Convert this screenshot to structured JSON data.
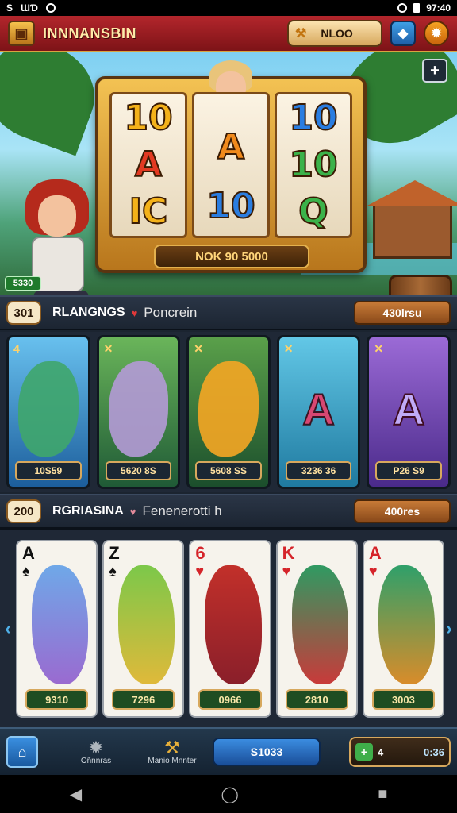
{
  "status_bar": {
    "left_icons": [
      "S",
      "ƜƊ"
    ],
    "right_text": "97:40"
  },
  "header": {
    "title": "INNNANSBIN",
    "coins": "NLOO",
    "logo_icon": "chest-icon"
  },
  "slot": {
    "reels": [
      [
        "10",
        "A",
        "IC"
      ],
      [
        "",
        "A",
        "10"
      ],
      [
        "10",
        "10",
        "Q"
      ]
    ],
    "bar_text": "NOK 90 5000"
  },
  "hero": {
    "level_chip": "5330"
  },
  "section1": {
    "num": "301",
    "title": "RLANGNGS",
    "subtitle": "Poncrein",
    "button": "430lrsu"
  },
  "cards1": [
    {
      "badge": "4",
      "label": "10S59",
      "color": "#2a7fc4"
    },
    {
      "badge": "✕",
      "label": "5620 8S",
      "color": "#2d7a45"
    },
    {
      "badge": "✕",
      "label": "5608 SS",
      "color": "#2c6a3a"
    },
    {
      "badge": "✕",
      "label": "3236 36",
      "color": "#2b97b8",
      "letter": "A"
    },
    {
      "badge": "✕",
      "label": "P26 S9",
      "color": "#6e3fb0",
      "letter": "A"
    }
  ],
  "section2": {
    "num": "200",
    "title": "RGRIASINA",
    "subtitle": "Fenenerotti h",
    "button": "400res"
  },
  "cards2": [
    {
      "rank": "A",
      "suit": "♠",
      "label": "9310",
      "suit_color": "blk"
    },
    {
      "rank": "Z",
      "suit": "♠",
      "label": "7296",
      "suit_color": "blk"
    },
    {
      "rank": "6",
      "suit": "♥",
      "label": "0966",
      "suit_color": "red"
    },
    {
      "rank": "K",
      "suit": "♥",
      "label": "2810",
      "suit_color": "red"
    },
    {
      "rank": "A",
      "suit": "♥",
      "label": "3003",
      "suit_color": "red"
    }
  ],
  "bottom_bar": {
    "item1": "Oñnnras",
    "item2": "Manio Mnnter",
    "play_label": "S1033",
    "balance_num": "4",
    "balance": "0:36"
  }
}
